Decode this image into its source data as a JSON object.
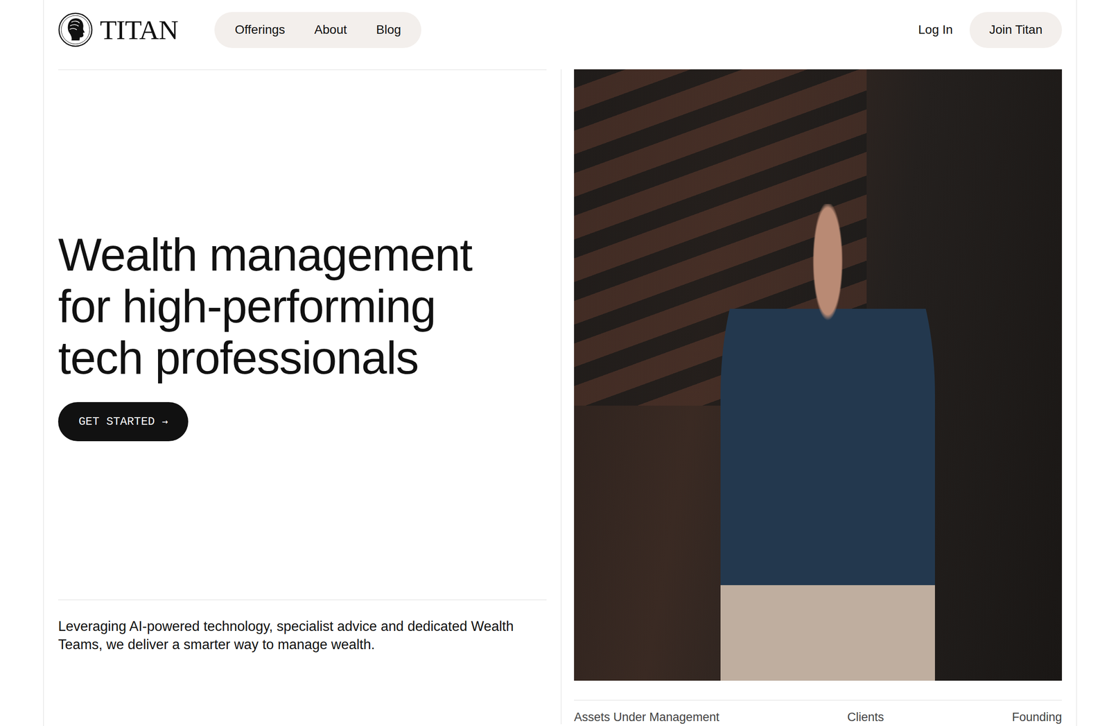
{
  "brand": {
    "name": "TITAN"
  },
  "nav": [
    "Offerings",
    "About",
    "Blog"
  ],
  "actions": {
    "login": "Log In",
    "join": "Join Titan"
  },
  "hero": {
    "headline": [
      "Wealth management",
      "for high-performing",
      "tech professionals"
    ],
    "cta": "GET STARTED",
    "cta_icon": "→",
    "description": "Leveraging AI-powered technology, specialist advice and dedicated Wealth Teams, we deliver a smarter way to manage wealth."
  },
  "stats": [
    {
      "label": "Assets Under Management"
    },
    {
      "label": "Clients"
    },
    {
      "label": "Founding"
    }
  ]
}
